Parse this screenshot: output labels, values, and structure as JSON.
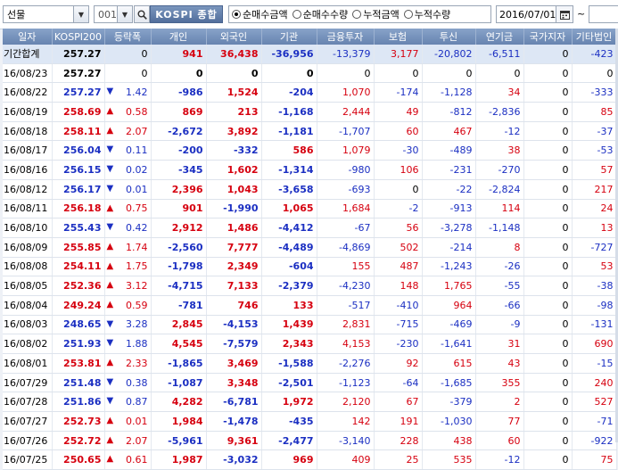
{
  "toolbar": {
    "market": "선물",
    "code": "001",
    "index_name": "KOSPI 종합",
    "modes": [
      {
        "label": "순매수금액",
        "selected": true
      },
      {
        "label": "순매수수량",
        "selected": false
      },
      {
        "label": "누적금액",
        "selected": false
      },
      {
        "label": "누적수량",
        "selected": false
      }
    ],
    "date": "2016/07/01",
    "tilde": "~"
  },
  "columns": [
    "일자",
    "KOSPI200",
    "등락폭",
    "개인",
    "외국인",
    "기관",
    "금융투자",
    "보험",
    "투신",
    "연기금",
    "국가지자",
    "기타법인"
  ],
  "colors": {
    "up": "#d6000f",
    "down": "#1b2fc2",
    "header": "#6784b0"
  },
  "rows": [
    {
      "date": "기간합계",
      "k": "257.27",
      "arrow": "",
      "chg": "0",
      "v": [
        "941",
        "36,438",
        "-36,956",
        "-13,379",
        "3,177",
        "-20,802",
        "-6,511",
        "0",
        "-423"
      ],
      "sum": true
    },
    {
      "date": "16/08/23",
      "k": "257.27",
      "arrow": "",
      "chg": "0",
      "v": [
        "0",
        "0",
        "0",
        "0",
        "0",
        "0",
        "0",
        "0",
        "0"
      ]
    },
    {
      "date": "16/08/22",
      "k": "257.27",
      "arrow": "down",
      "chg": "1.42",
      "v": [
        "-986",
        "1,524",
        "-204",
        "1,070",
        "-174",
        "-1,128",
        "34",
        "0",
        "-333"
      ]
    },
    {
      "date": "16/08/19",
      "k": "258.69",
      "arrow": "up",
      "chg": "0.58",
      "v": [
        "869",
        "213",
        "-1,168",
        "2,444",
        "49",
        "-812",
        "-2,836",
        "0",
        "85"
      ]
    },
    {
      "date": "16/08/18",
      "k": "258.11",
      "arrow": "up",
      "chg": "2.07",
      "v": [
        "-2,672",
        "3,892",
        "-1,181",
        "-1,707",
        "60",
        "467",
        "-12",
        "0",
        "-37"
      ]
    },
    {
      "date": "16/08/17",
      "k": "256.04",
      "arrow": "down",
      "chg": "0.11",
      "v": [
        "-200",
        "-332",
        "586",
        "1,079",
        "-30",
        "-489",
        "38",
        "0",
        "-53"
      ]
    },
    {
      "date": "16/08/16",
      "k": "256.15",
      "arrow": "down",
      "chg": "0.02",
      "v": [
        "-345",
        "1,602",
        "-1,314",
        "-980",
        "106",
        "-231",
        "-270",
        "0",
        "57"
      ]
    },
    {
      "date": "16/08/12",
      "k": "256.17",
      "arrow": "down",
      "chg": "0.01",
      "v": [
        "2,396",
        "1,043",
        "-3,658",
        "-693",
        "0",
        "-22",
        "-2,824",
        "0",
        "217"
      ]
    },
    {
      "date": "16/08/11",
      "k": "256.18",
      "arrow": "up",
      "chg": "0.75",
      "v": [
        "901",
        "-1,990",
        "1,065",
        "1,684",
        "-2",
        "-913",
        "114",
        "0",
        "24"
      ]
    },
    {
      "date": "16/08/10",
      "k": "255.43",
      "arrow": "down",
      "chg": "0.42",
      "v": [
        "2,912",
        "1,486",
        "-4,412",
        "-67",
        "56",
        "-3,278",
        "-1,148",
        "0",
        "13"
      ]
    },
    {
      "date": "16/08/09",
      "k": "255.85",
      "arrow": "up",
      "chg": "1.74",
      "v": [
        "-2,560",
        "7,777",
        "-4,489",
        "-4,869",
        "502",
        "-214",
        "8",
        "0",
        "-727"
      ]
    },
    {
      "date": "16/08/08",
      "k": "254.11",
      "arrow": "up",
      "chg": "1.75",
      "v": [
        "-1,798",
        "2,349",
        "-604",
        "155",
        "487",
        "-1,243",
        "-26",
        "0",
        "53"
      ]
    },
    {
      "date": "16/08/05",
      "k": "252.36",
      "arrow": "up",
      "chg": "3.12",
      "v": [
        "-4,715",
        "7,133",
        "-2,379",
        "-4,230",
        "148",
        "1,765",
        "-55",
        "0",
        "-38"
      ]
    },
    {
      "date": "16/08/04",
      "k": "249.24",
      "arrow": "up",
      "chg": "0.59",
      "v": [
        "-781",
        "746",
        "133",
        "-517",
        "-410",
        "964",
        "-66",
        "0",
        "-98"
      ]
    },
    {
      "date": "16/08/03",
      "k": "248.65",
      "arrow": "down",
      "chg": "3.28",
      "v": [
        "2,845",
        "-4,153",
        "1,439",
        "2,831",
        "-715",
        "-469",
        "-9",
        "0",
        "-131"
      ]
    },
    {
      "date": "16/08/02",
      "k": "251.93",
      "arrow": "down",
      "chg": "1.88",
      "v": [
        "4,545",
        "-7,579",
        "2,343",
        "4,153",
        "-230",
        "-1,641",
        "31",
        "0",
        "690"
      ]
    },
    {
      "date": "16/08/01",
      "k": "253.81",
      "arrow": "up",
      "chg": "2.33",
      "v": [
        "-1,865",
        "3,469",
        "-1,588",
        "-2,276",
        "92",
        "615",
        "43",
        "0",
        "-15"
      ]
    },
    {
      "date": "16/07/29",
      "k": "251.48",
      "arrow": "down",
      "chg": "0.38",
      "v": [
        "-1,087",
        "3,348",
        "-2,501",
        "-1,123",
        "-64",
        "-1,685",
        "355",
        "0",
        "240"
      ]
    },
    {
      "date": "16/07/28",
      "k": "251.86",
      "arrow": "down",
      "chg": "0.87",
      "v": [
        "4,282",
        "-6,781",
        "1,972",
        "2,120",
        "67",
        "-379",
        "2",
        "0",
        "527"
      ]
    },
    {
      "date": "16/07/27",
      "k": "252.73",
      "arrow": "up",
      "chg": "0.01",
      "v": [
        "1,984",
        "-1,478",
        "-435",
        "142",
        "191",
        "-1,030",
        "77",
        "0",
        "-71"
      ]
    },
    {
      "date": "16/07/26",
      "k": "252.72",
      "arrow": "up",
      "chg": "2.07",
      "v": [
        "-5,961",
        "9,361",
        "-2,477",
        "-3,140",
        "228",
        "438",
        "60",
        "0",
        "-922"
      ]
    },
    {
      "date": "16/07/25",
      "k": "250.65",
      "arrow": "up",
      "chg": "0.61",
      "v": [
        "1,987",
        "-3,032",
        "969",
        "409",
        "25",
        "535",
        "-12",
        "0",
        "75"
      ]
    }
  ]
}
